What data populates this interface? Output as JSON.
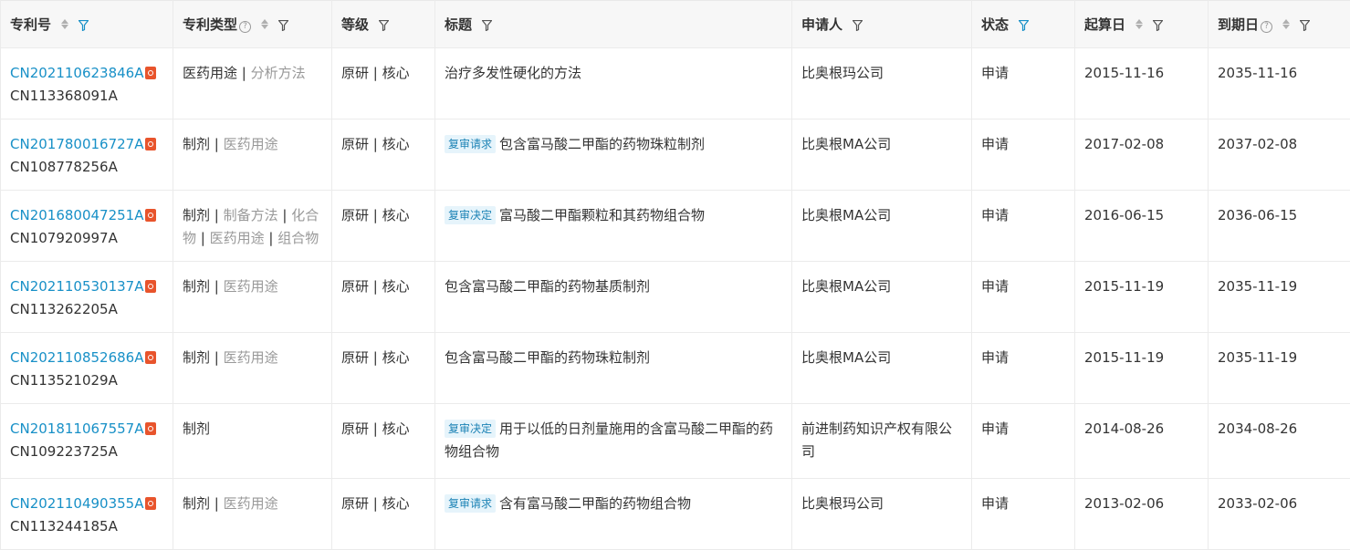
{
  "headers": {
    "patent_no": "专利号",
    "patent_type": "专利类型",
    "level": "等级",
    "title": "标题",
    "applicant": "申请人",
    "status": "状态",
    "start_date": "起算日",
    "expiry_date": "到期日"
  },
  "colors": {
    "link": "#1890c7",
    "filter_active": "#1890c7",
    "filter_default": "#555555",
    "pdf_icon": "#e8542c",
    "tag_bg": "#e6f4fb"
  },
  "rows": [
    {
      "app_no": "CN202110623846A",
      "pub_no": "CN113368091A",
      "types": [
        {
          "text": "医药用途",
          "muted": false
        },
        {
          "text": "分析方法",
          "muted": true
        }
      ],
      "level": "原研 | 核心",
      "tag": "",
      "title": "治疗多发性硬化的方法",
      "applicant": "比奥根玛公司",
      "status": "申请",
      "start": "2015-11-16",
      "expiry": "2035-11-16"
    },
    {
      "app_no": "CN201780016727A",
      "pub_no": "CN108778256A",
      "types": [
        {
          "text": "制剂",
          "muted": false
        },
        {
          "text": "医药用途",
          "muted": true
        }
      ],
      "level": "原研 | 核心",
      "tag": "复审请求",
      "title": "包含富马酸二甲酯的药物珠粒制剂",
      "applicant": "比奥根MA公司",
      "status": "申请",
      "start": "2017-02-08",
      "expiry": "2037-02-08"
    },
    {
      "app_no": "CN201680047251A",
      "pub_no": "CN107920997A",
      "types": [
        {
          "text": "制剂",
          "muted": false
        },
        {
          "text": "制备方法",
          "muted": true
        },
        {
          "text": "化合物",
          "muted": true
        },
        {
          "text": "医药用途",
          "muted": true
        },
        {
          "text": "组合物",
          "muted": true
        }
      ],
      "level": "原研 | 核心",
      "tag": "复审决定",
      "title": "富马酸二甲酯颗粒和其药物组合物",
      "applicant": "比奥根MA公司",
      "status": "申请",
      "start": "2016-06-15",
      "expiry": "2036-06-15"
    },
    {
      "app_no": "CN202110530137A",
      "pub_no": "CN113262205A",
      "types": [
        {
          "text": "制剂",
          "muted": false
        },
        {
          "text": "医药用途",
          "muted": true
        }
      ],
      "level": "原研 | 核心",
      "tag": "",
      "title": "包含富马酸二甲酯的药物基质制剂",
      "applicant": "比奥根MA公司",
      "status": "申请",
      "start": "2015-11-19",
      "expiry": "2035-11-19"
    },
    {
      "app_no": "CN202110852686A",
      "pub_no": "CN113521029A",
      "types": [
        {
          "text": "制剂",
          "muted": false
        },
        {
          "text": "医药用途",
          "muted": true
        }
      ],
      "level": "原研 | 核心",
      "tag": "",
      "title": "包含富马酸二甲酯的药物珠粒制剂",
      "applicant": "比奥根MA公司",
      "status": "申请",
      "start": "2015-11-19",
      "expiry": "2035-11-19"
    },
    {
      "app_no": "CN201811067557A",
      "pub_no": "CN109223725A",
      "types": [
        {
          "text": "制剂",
          "muted": false
        }
      ],
      "level": "原研 | 核心",
      "tag": "复审决定",
      "title": "用于以低的日剂量施用的含富马酸二甲酯的药物组合物",
      "applicant": "前进制药知识产权有限公司",
      "status": "申请",
      "start": "2014-08-26",
      "expiry": "2034-08-26"
    },
    {
      "app_no": "CN202110490355A",
      "pub_no": "CN113244185A",
      "types": [
        {
          "text": "制剂",
          "muted": false
        },
        {
          "text": "医药用途",
          "muted": true
        }
      ],
      "level": "原研 | 核心",
      "tag": "复审请求",
      "title": "含有富马酸二甲酯的药物组合物",
      "applicant": "比奥根玛公司",
      "status": "申请",
      "start": "2013-02-06",
      "expiry": "2033-02-06"
    }
  ]
}
